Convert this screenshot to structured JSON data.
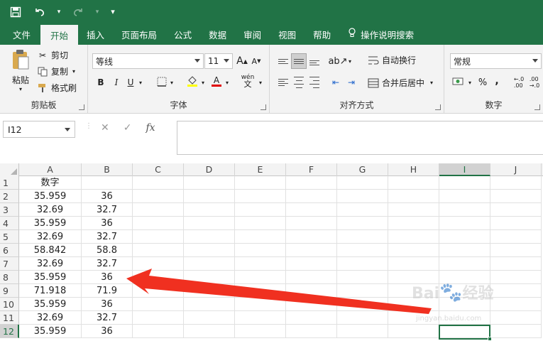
{
  "quick_access": {
    "save_icon": "save-icon",
    "undo_icon": "undo-icon",
    "redo_icon": "redo-icon",
    "customize_icon": "customize-icon"
  },
  "tabs": [
    {
      "label": "文件"
    },
    {
      "label": "开始"
    },
    {
      "label": "插入"
    },
    {
      "label": "页面布局"
    },
    {
      "label": "公式"
    },
    {
      "label": "数据"
    },
    {
      "label": "审阅"
    },
    {
      "label": "视图"
    },
    {
      "label": "帮助"
    },
    {
      "label": "操作说明搜索"
    }
  ],
  "ribbon": {
    "clipboard": {
      "label": "剪贴板",
      "paste": "粘贴",
      "cut": "剪切",
      "copy": "复制",
      "format_painter": "格式刷"
    },
    "font": {
      "label": "字体",
      "font_name": "等线",
      "font_size": "11",
      "bold": "B",
      "italic": "I",
      "underline": "U",
      "grow": "A",
      "shrink": "A",
      "font_color": "A",
      "wen": "wén"
    },
    "alignment": {
      "label": "对齐方式",
      "wrap_text": "自动换行",
      "merge_center": "合并后居中"
    },
    "number": {
      "label": "数字",
      "format": "常规",
      "percent": "%",
      "comma": ","
    }
  },
  "formula_bar": {
    "name_box": "I12",
    "cancel": "✕",
    "enter": "✓",
    "fx": "fx",
    "value": ""
  },
  "columns": [
    "A",
    "B",
    "C",
    "D",
    "E",
    "F",
    "G",
    "H",
    "I",
    "J"
  ],
  "rows": [
    {
      "num": "1",
      "a": "数字",
      "b": ""
    },
    {
      "num": "2",
      "a": "35.959",
      "b": "36"
    },
    {
      "num": "3",
      "a": "32.69",
      "b": "32.7"
    },
    {
      "num": "4",
      "a": "35.959",
      "b": "36"
    },
    {
      "num": "5",
      "a": "32.69",
      "b": "32.7"
    },
    {
      "num": "6",
      "a": "58.842",
      "b": "58.8"
    },
    {
      "num": "7",
      "a": "32.69",
      "b": "32.7"
    },
    {
      "num": "8",
      "a": "35.959",
      "b": "36"
    },
    {
      "num": "9",
      "a": "71.918",
      "b": "71.9"
    },
    {
      "num": "10",
      "a": "35.959",
      "b": "36"
    },
    {
      "num": "11",
      "a": "32.69",
      "b": "32.7"
    },
    {
      "num": "12",
      "a": "35.959",
      "b": "36"
    }
  ],
  "selection": {
    "column": "I",
    "row": "12"
  },
  "watermark": {
    "brand": "Bai",
    "brand2": "经验",
    "url": "jingyan.baidu.com"
  },
  "colors": {
    "excel_green": "#217346",
    "arrow_red": "#f03020"
  }
}
